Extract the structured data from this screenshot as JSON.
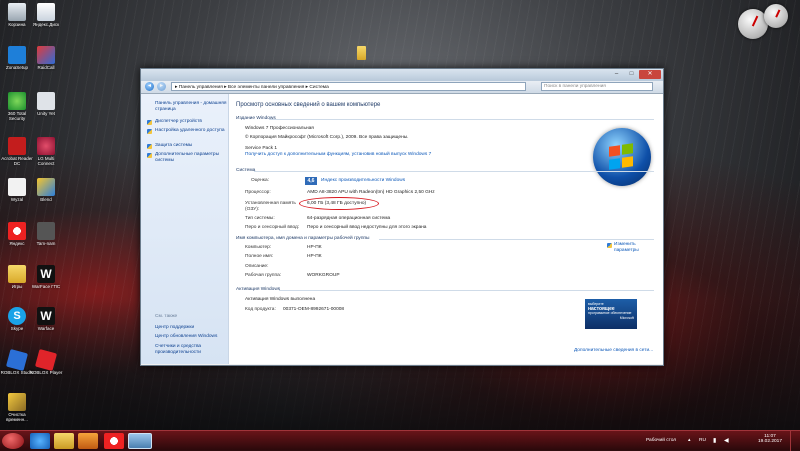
{
  "desktop_icons": [
    {
      "label": "Корзина",
      "icon": "recycle-bin-icon"
    },
    {
      "label": "Яндекс.Диск",
      "icon": "yandex-disk-icon"
    },
    {
      "label": "ZonaSetup",
      "icon": "zona-icon"
    },
    {
      "label": "RaidCall",
      "icon": "raidcall-icon"
    },
    {
      "label": "360 Total Security",
      "icon": "security-shield-icon"
    },
    {
      "label": "Unity Yet",
      "icon": "unity-icon"
    },
    {
      "label": "Acrobat Reader DC",
      "icon": "acrobat-icon"
    },
    {
      "label": "LG Multi Connect",
      "icon": "lg-icon"
    },
    {
      "label": "Wyzal",
      "icon": "document-icon"
    },
    {
      "label": "Blend",
      "icon": "blend-icon"
    },
    {
      "label": "Яндекс",
      "icon": "yandex-browser-icon"
    },
    {
      "label": "Tam-nam",
      "icon": "app-icon"
    },
    {
      "label": "Игры",
      "icon": "games-folder-icon"
    },
    {
      "label": "WarFace ГПС",
      "icon": "warface-icon"
    },
    {
      "label": "Skype",
      "icon": "skype-icon"
    },
    {
      "label": "Warface",
      "icon": "warface-icon"
    },
    {
      "label": "ROBLOX Studio",
      "icon": "roblox-studio-icon"
    },
    {
      "label": "ROBLOX Player",
      "icon": "roblox-player-icon"
    },
    {
      "label": "Очистка временн...",
      "icon": "cleanup-icon"
    }
  ],
  "window": {
    "address": {
      "crumbs": [
        "Панель управления",
        "Все элементы панели управления",
        "Система"
      ],
      "search_placeholder": "Поиск в панели управления"
    },
    "sidebar": {
      "home": "Панель управления - домашняя страница",
      "links": [
        "Диспетчер устройств",
        "Настройка удаленного доступа",
        "Защита системы",
        "Дополнительные параметры системы"
      ],
      "see_also_heading": "См. также",
      "see_also": [
        "Центр поддержки",
        "Центр обновления Windows",
        "Счетчики и средства производительности"
      ]
    },
    "main": {
      "title": "Просмотр основных сведений о вашем компьютере",
      "edition_heading": "Издание Windows",
      "edition": "Windows 7 Профессиональная",
      "copyright": "© Корпорация Майкрософт (Microsoft Corp.), 2009. Все права защищены.",
      "service_pack": "Service Pack 1",
      "upgrade_link": "Получить доступ к дополнительным функциям, установив новый выпуск Windows 7",
      "system_heading": "Система",
      "rating_label": "Оценка:",
      "rating_score": "4,6",
      "rating_link": "Индекс производительности Windows",
      "processor_label": "Процессор:",
      "processor_value": "AMD A8-3820 APU with Radeon(tm) HD Graphics   2,50 GHz",
      "memory_label": "Установленная память (ОЗУ):",
      "memory_value": "6,00 ГБ (3,48 ГБ доступно)",
      "system_type_label": "Тип системы:",
      "system_type_value": "64-разрядная операционная система",
      "pen_label": "Перо и сенсорный ввод:",
      "pen_value": "Перо и сенсорный ввод недоступны для этого экрана",
      "computer_heading": "Имя компьютера, имя домена и параметры рабочей группы",
      "change_settings": "Изменить параметры",
      "computer_label": "Компьютер:",
      "computer_value": "HP-ПК",
      "full_name_label": "Полное имя:",
      "full_name_value": "HP-ПК",
      "description_label": "Описание:",
      "description_value": "",
      "workgroup_label": "Рабочая группа:",
      "workgroup_value": "WORKGROUP",
      "activation_heading": "Активация Windows",
      "activation_status": "Активация Windows выполнена",
      "product_id_label": "Код продукта:",
      "product_id_value": "00371-OEM-8992671-00008",
      "genuine_line1": "выберите",
      "genuine_line2": "настоящее",
      "genuine_line3": "программное обеспечение",
      "genuine_line4": "Microsoft",
      "more_info_link": "Дополнительные сведения в сети..."
    }
  },
  "taskbar": {
    "desktop_label": "Рабочий стол",
    "lang": "RU",
    "time": "11:07",
    "date": "19.02.2017"
  },
  "colors": {
    "accent": "#d8181f",
    "link": "#0b57b8",
    "taskbar": "#6e1419"
  }
}
